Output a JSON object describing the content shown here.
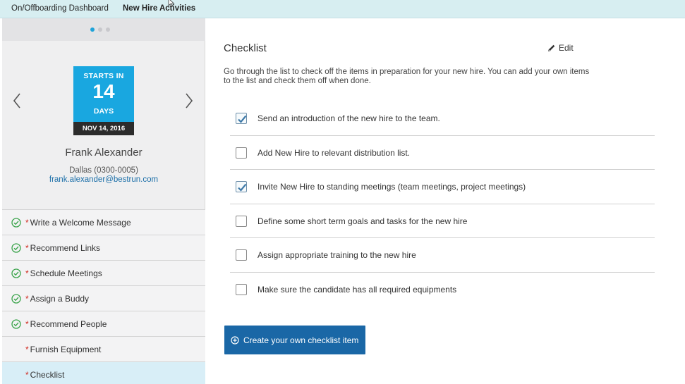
{
  "topbar": {
    "tabs": [
      {
        "label": "On/Offboarding Dashboard"
      },
      {
        "label": "New Hire Activities"
      }
    ]
  },
  "colors": {
    "accent": "#19a7e0",
    "primary_button": "#1a67a6",
    "success": "#3aa34a",
    "required": "#d0271d",
    "topbar": "#d7eef1"
  },
  "carousel": {
    "page_count": 3,
    "current_page": 1
  },
  "countdown": {
    "line1": "STARTS IN",
    "number": "14",
    "line3": "DAYS",
    "date": "NOV 14, 2016"
  },
  "new_hire": {
    "name": "Frank Alexander",
    "location": "Dallas (0300-0005)",
    "email": "frank.alexander@bestrun.com"
  },
  "tasks": [
    {
      "label": "Write a Welcome Message",
      "required_mark": "*",
      "done": true
    },
    {
      "label": "Recommend Links",
      "required_mark": "*",
      "done": true
    },
    {
      "label": "Schedule Meetings",
      "required_mark": "*",
      "done": true
    },
    {
      "label": "Assign a Buddy",
      "required_mark": "*",
      "done": true
    },
    {
      "label": "Recommend People",
      "required_mark": "*",
      "done": true
    },
    {
      "label": "Furnish Equipment",
      "required_mark": "*",
      "done": false
    },
    {
      "label": "Checklist",
      "required_mark": "*",
      "done": false,
      "active": true
    }
  ],
  "checklist": {
    "title": "Checklist",
    "edit_label": "Edit",
    "description": "Go through the list to check off the items in preparation for your new hire. You can add your own items to the list and check them off when done.",
    "items": [
      {
        "text": "Send an introduction of the new hire to the team.",
        "checked": true
      },
      {
        "text": "Add New Hire to relevant distribution list.",
        "checked": false
      },
      {
        "text": "Invite New Hire to standing meetings (team meetings, project meetings)",
        "checked": true
      },
      {
        "text": "Define some short term goals and tasks for the new hire",
        "checked": false
      },
      {
        "text": "Assign appropriate training to the new hire",
        "checked": false
      },
      {
        "text": "Make sure the candidate has all required equipments",
        "checked": false
      }
    ],
    "create_button_label": "Create your own checklist item"
  }
}
